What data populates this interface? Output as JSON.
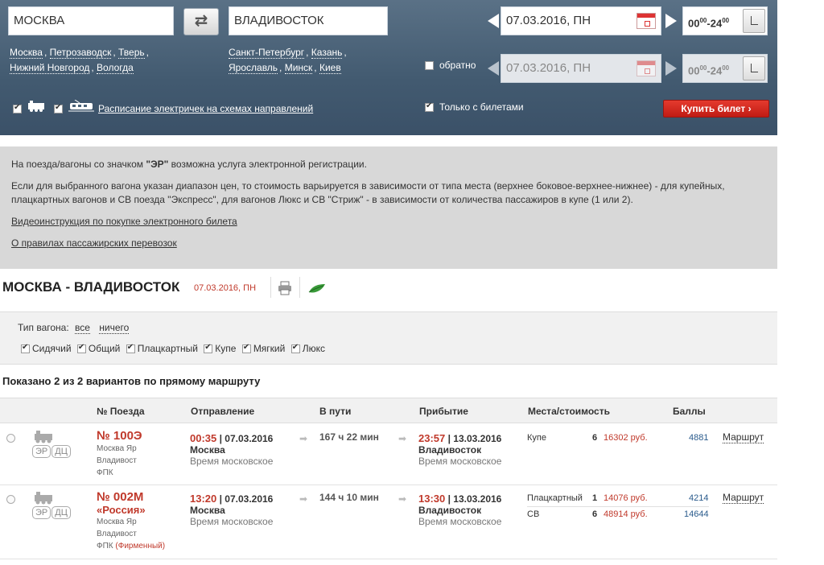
{
  "search": {
    "from": "МОСКВА",
    "to": "ВЛАДИВОСТОК",
    "from_suggest": [
      "Москва",
      "Петрозаводск",
      "Тверь",
      "Нижний Новгород",
      "Вологда"
    ],
    "to_suggest": [
      "Санкт-Петербург",
      "Казань",
      "Ярославль",
      "Минск",
      "Киев"
    ],
    "date": "07.03.2016, ПН",
    "time_from": "00",
    "time_from_sup": "00",
    "time_to": "24",
    "time_to_sup": "00",
    "return_label": "обратно",
    "return_date": "07.03.2016, ПН",
    "suburban_link": "Расписание электричек на схемах направлений",
    "only_tickets_label": "Только с билетами",
    "buy_button": "Купить билет"
  },
  "info": {
    "line1_pre": "На поезда/вагоны со значком ",
    "line1_bold": "\"ЭР\"",
    "line1_post": " возможна услуга электронной регистрации.",
    "line2": "Если для выбранного вагона указан диапазон цен, то стоимость варьируется в зависимости от типа места (верхнее боковое-верхнее-нижнее) - для купейных, плацкартных вагонов и СВ поезда \"Экспресс\", для вагонов Люкс и СВ \"Стриж\" - в зависимости от количества пассажиров в купе (1 или 2).",
    "video_link": "Видеоинструкция по покупке электронного билета",
    "rules_link": "О правилах пассажирских перевозок"
  },
  "route": {
    "title": "МОСКВА - ВЛАДИВОСТОК",
    "date": "07.03.2016, ПН"
  },
  "filter": {
    "type_label": "Тип вагона:",
    "all": "все",
    "none": "ничего",
    "types": [
      "Сидячий",
      "Общий",
      "Плацкартный",
      "Купе",
      "Мягкий",
      "Люкс"
    ]
  },
  "shown_text": "Показано 2 из 2 вариантов по прямому маршруту",
  "table": {
    "headers": {
      "train": "№ Поезда",
      "departure": "Отправление",
      "travel": "В пути",
      "arrival": "Прибытие",
      "seats": "Места/стоимость",
      "points": "Баллы"
    },
    "rows": [
      {
        "number": "№ 100Э",
        "name": "",
        "route1": "Москва Яр",
        "route2": "Владивост",
        "carrier": "ФПК",
        "carrier_extra": "",
        "dep_time": "00:35",
        "dep_date": "| 07.03.2016",
        "dep_city": "Москва",
        "dep_tz": "Время московское",
        "duration": "167 ч 22 мин",
        "arr_time": "23:57",
        "arr_date": "| 13.03.2016",
        "arr_city": "Владивосток",
        "arr_tz": "Время московское",
        "seats": [
          {
            "type": "Купе",
            "count": "6",
            "price": "16302 руб.",
            "points": "4881"
          }
        ],
        "route_link": "Маршрут"
      },
      {
        "number": "№ 002М",
        "name": "«Россия»",
        "route1": "Москва Яр",
        "route2": "Владивост",
        "carrier": "ФПК",
        "carrier_extra": "(Фирменный)",
        "dep_time": "13:20",
        "dep_date": "| 07.03.2016",
        "dep_city": "Москва",
        "dep_tz": "Время московское",
        "duration": "144 ч 10 мин",
        "arr_time": "13:30",
        "arr_date": "| 13.03.2016",
        "arr_city": "Владивосток",
        "arr_tz": "Время московское",
        "seats": [
          {
            "type": "Плацкартный",
            "count": "1",
            "price": "14076 руб.",
            "points": "4214"
          },
          {
            "type": "СВ",
            "count": "6",
            "price": "48914 руб.",
            "points": "14644"
          }
        ],
        "route_link": "Маршрут"
      }
    ],
    "badges": [
      "ЭР",
      "ДЦ"
    ]
  }
}
